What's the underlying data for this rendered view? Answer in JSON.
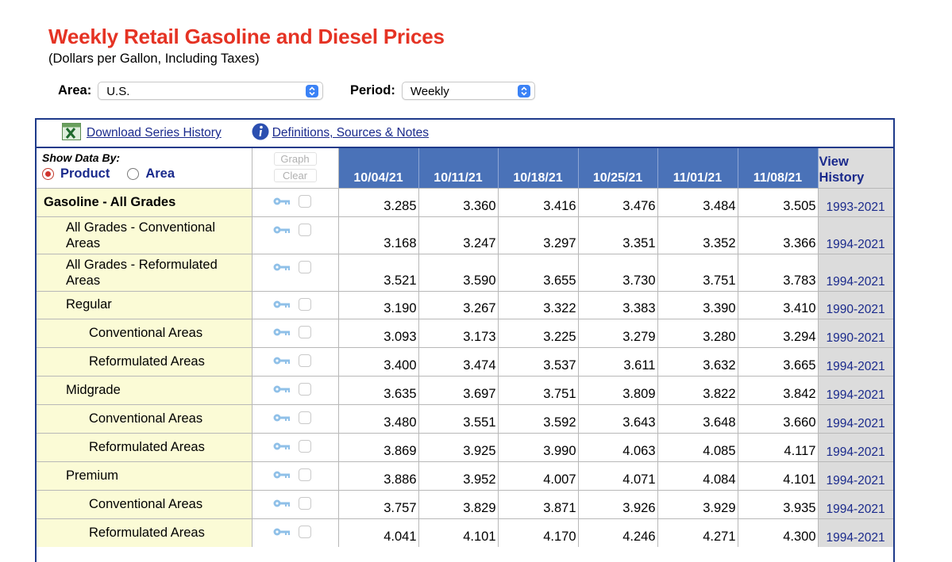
{
  "header": {
    "title": "Weekly Retail Gasoline and Diesel Prices",
    "subtitle": "(Dollars per Gallon, Including Taxes)"
  },
  "filters": {
    "area_label": "Area:",
    "area_value": "U.S.",
    "period_label": "Period:",
    "period_value": "Weekly"
  },
  "links": {
    "download": "Download Series History",
    "definitions": "Definitions, Sources & Notes"
  },
  "show_data_by": {
    "title": "Show Data By:",
    "options": [
      "Product",
      "Area"
    ],
    "selected": "Product"
  },
  "buttons": {
    "graph": "Graph",
    "clear": "Clear"
  },
  "columns": {
    "dates": [
      "10/04/21",
      "10/11/21",
      "10/18/21",
      "10/25/21",
      "11/01/21",
      "11/08/21"
    ],
    "history_label": "View History"
  },
  "rows": [
    {
      "label": "Gasoline - All Grades",
      "level": 0,
      "values": [
        "3.285",
        "3.360",
        "3.416",
        "3.476",
        "3.484",
        "3.505"
      ],
      "history": "1993-2021"
    },
    {
      "label": "All Grades - Conventional Areas",
      "level": 1,
      "values": [
        "3.168",
        "3.247",
        "3.297",
        "3.351",
        "3.352",
        "3.366"
      ],
      "history": "1994-2021"
    },
    {
      "label": "All Grades - Reformulated Areas",
      "level": 1,
      "values": [
        "3.521",
        "3.590",
        "3.655",
        "3.730",
        "3.751",
        "3.783"
      ],
      "history": "1994-2021"
    },
    {
      "label": "Regular",
      "level": 1,
      "values": [
        "3.190",
        "3.267",
        "3.322",
        "3.383",
        "3.390",
        "3.410"
      ],
      "history": "1990-2021"
    },
    {
      "label": "Conventional Areas",
      "level": 2,
      "values": [
        "3.093",
        "3.173",
        "3.225",
        "3.279",
        "3.280",
        "3.294"
      ],
      "history": "1990-2021"
    },
    {
      "label": "Reformulated Areas",
      "level": 2,
      "values": [
        "3.400",
        "3.474",
        "3.537",
        "3.611",
        "3.632",
        "3.665"
      ],
      "history": "1994-2021"
    },
    {
      "label": "Midgrade",
      "level": 1,
      "values": [
        "3.635",
        "3.697",
        "3.751",
        "3.809",
        "3.822",
        "3.842"
      ],
      "history": "1994-2021"
    },
    {
      "label": "Conventional Areas",
      "level": 2,
      "values": [
        "3.480",
        "3.551",
        "3.592",
        "3.643",
        "3.648",
        "3.660"
      ],
      "history": "1994-2021"
    },
    {
      "label": "Reformulated Areas",
      "level": 2,
      "values": [
        "3.869",
        "3.925",
        "3.990",
        "4.063",
        "4.085",
        "4.117"
      ],
      "history": "1994-2021"
    },
    {
      "label": "Premium",
      "level": 1,
      "values": [
        "3.886",
        "3.952",
        "4.007",
        "4.071",
        "4.084",
        "4.101"
      ],
      "history": "1994-2021"
    },
    {
      "label": "Conventional Areas",
      "level": 2,
      "values": [
        "3.757",
        "3.829",
        "3.871",
        "3.926",
        "3.929",
        "3.935"
      ],
      "history": "1994-2021"
    },
    {
      "label": "Reformulated Areas",
      "level": 2,
      "values": [
        "4.041",
        "4.101",
        "4.170",
        "4.246",
        "4.271",
        "4.300"
      ],
      "history": "1994-2021"
    }
  ],
  "colors": {
    "title": "#e53324",
    "date_header": "#4a72b8",
    "label_cell": "#fbfbd6",
    "history_cell": "#dcdcdc",
    "link": "#1a2a8c",
    "panel_border": "#1e3a8a"
  }
}
